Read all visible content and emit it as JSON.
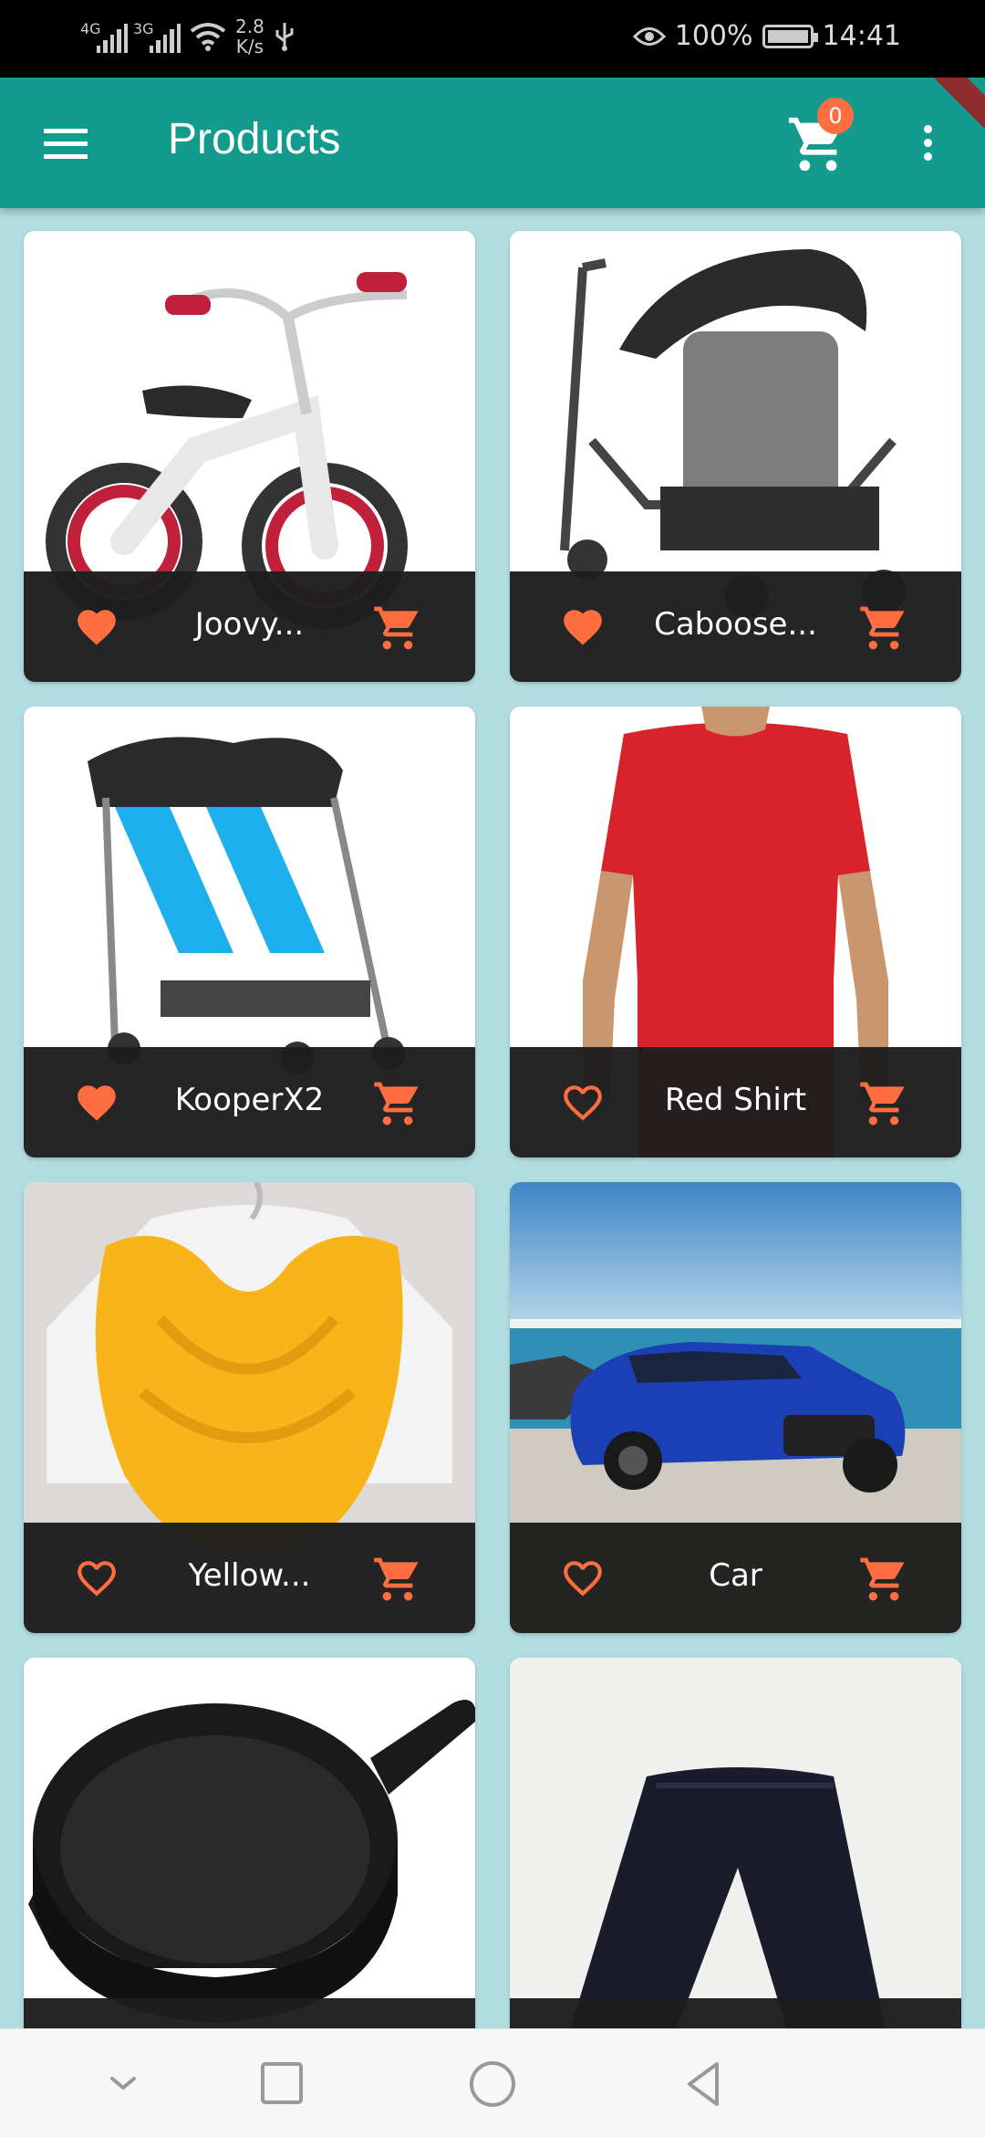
{
  "status_bar": {
    "network_1": "4G",
    "network_2": "3G",
    "speed_value": "2.8",
    "speed_unit": "K/s",
    "battery": "100%",
    "time": "14:41"
  },
  "app_bar": {
    "title": "Products",
    "cart_count": "0"
  },
  "colors": {
    "primary": "#139b8e",
    "accent": "#ff6e40",
    "background": "#b2dde0",
    "footer": "#1e1e1e"
  },
  "products": [
    {
      "name": "Joovy...",
      "favorite": true,
      "icon": "balance-bike"
    },
    {
      "name": "Caboose...",
      "favorite": true,
      "icon": "stroller"
    },
    {
      "name": "KooperX2",
      "favorite": true,
      "icon": "double-stroller"
    },
    {
      "name": "Red Shirt",
      "favorite": false,
      "icon": "red-shirt"
    },
    {
      "name": "Yellow...",
      "favorite": false,
      "icon": "yellow-scarf"
    },
    {
      "name": "Car",
      "favorite": false,
      "icon": "blue-car"
    },
    {
      "name": "",
      "favorite": false,
      "icon": "cast-iron-pot"
    },
    {
      "name": "",
      "favorite": false,
      "icon": "black-pants"
    }
  ],
  "nav_bar": {
    "icons": [
      "chevron-down-icon",
      "recents-square-icon",
      "home-circle-icon",
      "back-triangle-icon"
    ]
  }
}
